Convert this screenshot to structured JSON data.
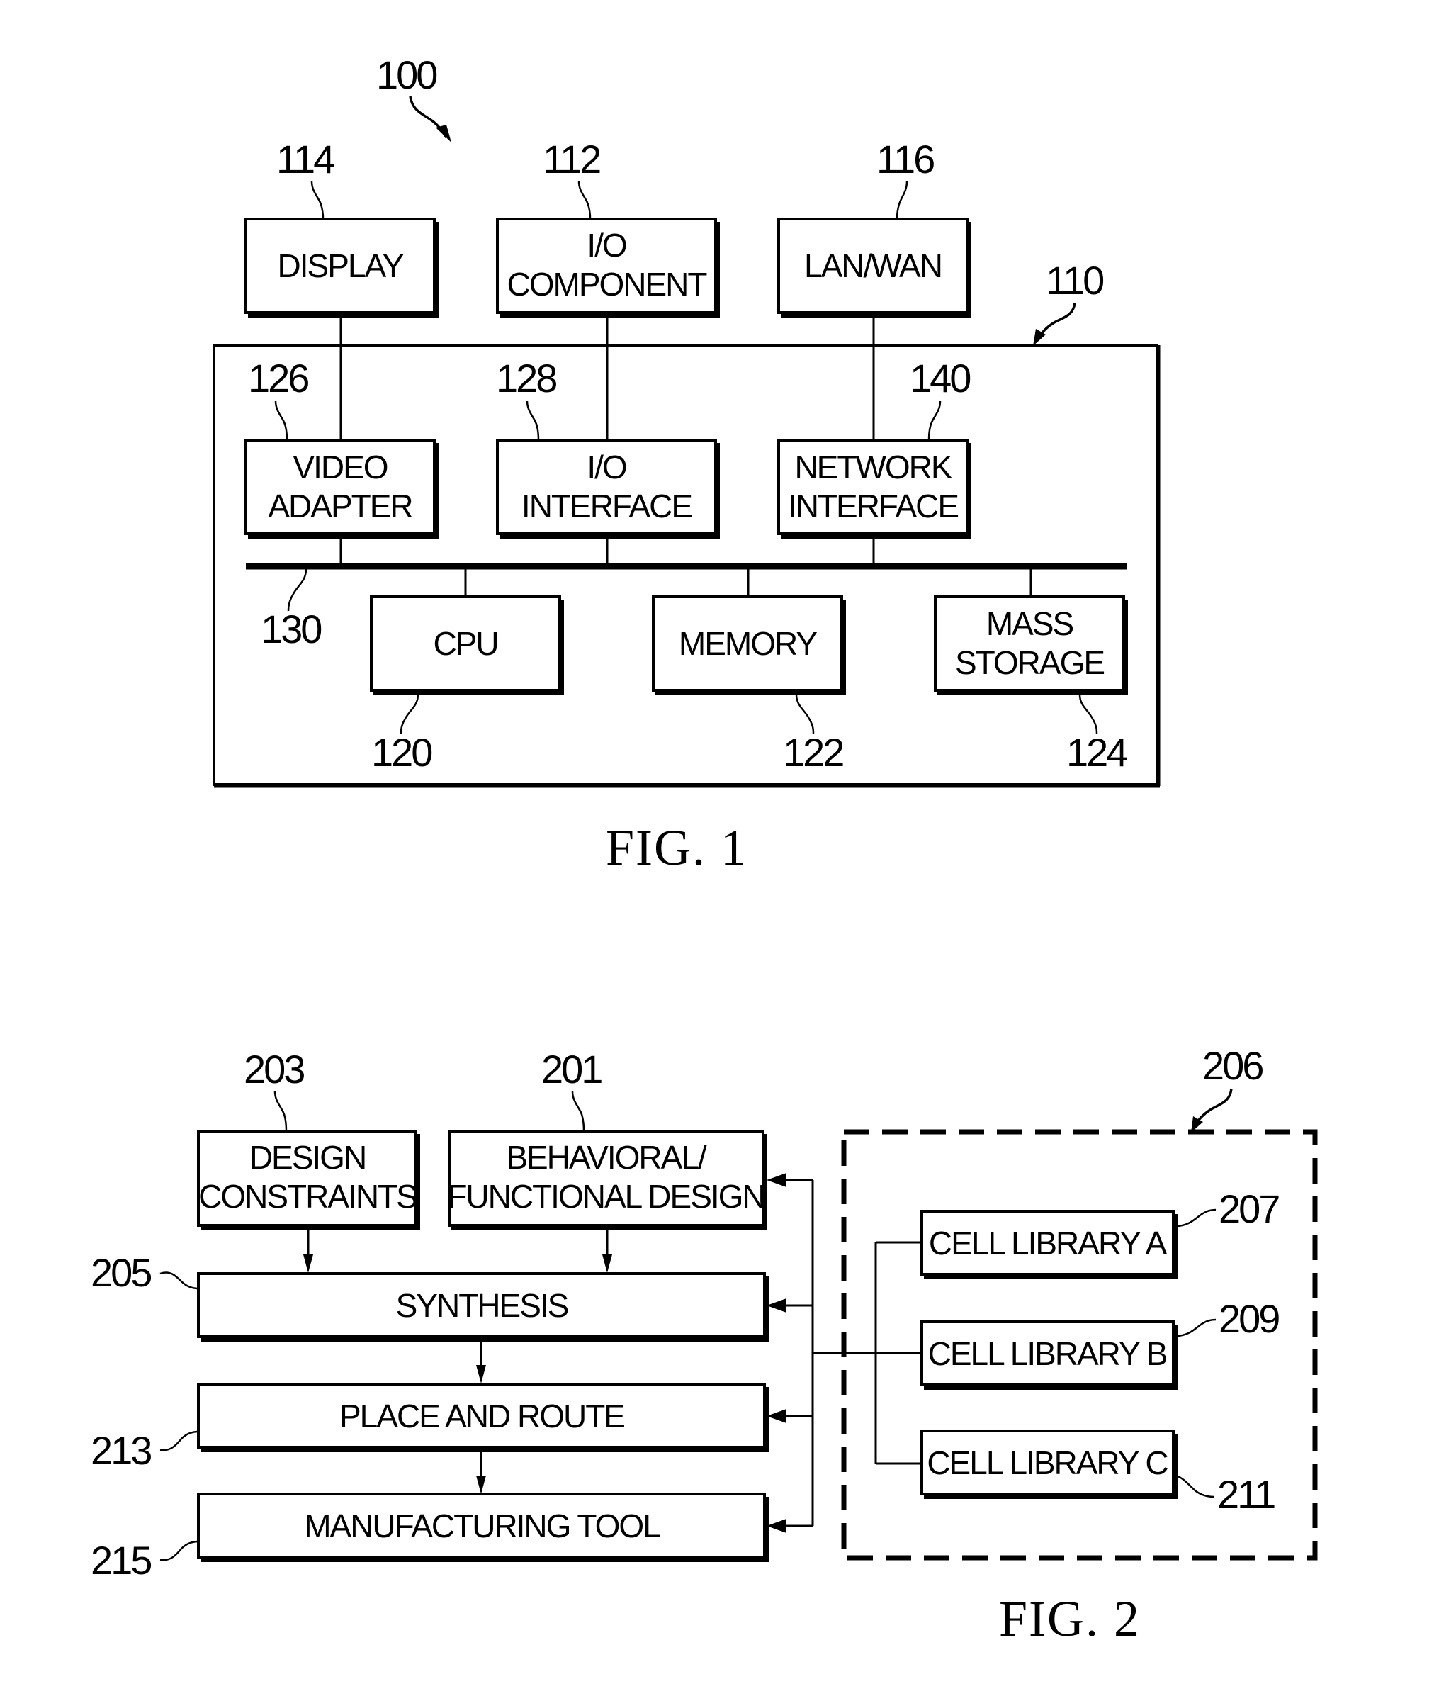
{
  "figure1": {
    "caption": "FIG. 1",
    "system_ref": "100",
    "processing_unit_ref": "110",
    "bus_ref": "130",
    "external_blocks": [
      {
        "id": "display",
        "ref": "114",
        "lines": [
          "DISPLAY"
        ]
      },
      {
        "id": "io-component",
        "ref": "112",
        "lines": [
          "I/O",
          "COMPONENT"
        ]
      },
      {
        "id": "lan-wan",
        "ref": "116",
        "lines": [
          "LAN/WAN"
        ]
      }
    ],
    "interface_blocks": [
      {
        "id": "video-adapter",
        "ref": "126",
        "lines": [
          "VIDEO",
          "ADAPTER"
        ]
      },
      {
        "id": "io-interface",
        "ref": "128",
        "lines": [
          "I/O",
          "INTERFACE"
        ]
      },
      {
        "id": "network-interface",
        "ref": "140",
        "lines": [
          "NETWORK",
          "INTERFACE"
        ]
      }
    ],
    "core_blocks": [
      {
        "id": "cpu",
        "ref": "120",
        "lines": [
          "CPU"
        ]
      },
      {
        "id": "memory",
        "ref": "122",
        "lines": [
          "MEMORY"
        ]
      },
      {
        "id": "mass-storage",
        "ref": "124",
        "lines": [
          "MASS",
          "STORAGE"
        ]
      }
    ]
  },
  "figure2": {
    "caption": "FIG. 2",
    "library_group_ref": "206",
    "input_blocks": [
      {
        "id": "design-constraints",
        "ref": "203",
        "lines": [
          "DESIGN",
          "CONSTRAINTS"
        ]
      },
      {
        "id": "behavioral-functional-design",
        "ref": "201",
        "lines": [
          "BEHAVIORAL/",
          "FUNCTIONAL DESIGN"
        ]
      }
    ],
    "flow_blocks": [
      {
        "id": "synthesis",
        "ref": "205",
        "label": "SYNTHESIS"
      },
      {
        "id": "place-and-route",
        "ref": "213",
        "label": "PLACE AND ROUTE"
      },
      {
        "id": "manufacturing-tool",
        "ref": "215",
        "label": "MANUFACTURING TOOL"
      }
    ],
    "cell_libraries": [
      {
        "id": "cell-library-a",
        "ref": "207",
        "label": "CELL LIBRARY A"
      },
      {
        "id": "cell-library-b",
        "ref": "209",
        "label": "CELL LIBRARY B"
      },
      {
        "id": "cell-library-c",
        "ref": "211",
        "label": "CELL LIBRARY C"
      }
    ]
  }
}
